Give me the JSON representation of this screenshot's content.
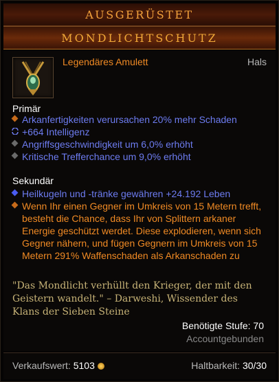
{
  "header": {
    "status": "AUSGERÜSTET",
    "item_name": "MONDLICHTSCHUTZ"
  },
  "item": {
    "type": "Legendäres Amulett",
    "slot": "Hals",
    "icon": "amulet-icon"
  },
  "primary": {
    "title": "Primär",
    "stats": [
      "Arkanfertigkeiten verursachen 20% mehr Schaden",
      "+664 Intelligenz",
      "Angriffsgeschwindigkeit um 6,0% erhöht",
      "Kritische Trefferchance um 9,0% erhöht"
    ]
  },
  "secondary": {
    "title": "Sekundär",
    "stats": [
      "Heilkugeln und -tränke gewähren +24.192 Leben",
      "Wenn Ihr einen Gegner im Umkreis von 15 Metern trefft, besteht die Chance, dass Ihr von Splittern arkaner Energie geschützt werdet. Diese explodieren, wenn sich Gegner nähern, und fügen Gegnern im Umkreis von 15 Metern 291% Waffenschaden als Arkanschaden zu"
    ]
  },
  "flavor": "\"Das Mondlicht verhüllt den Krieger, der mit den Geistern wandelt.\" – Darweshi, Wissender des Klans der Sieben Steine",
  "requirements": {
    "level": "Benötigte Stufe: 70",
    "bound": "Accountgebunden"
  },
  "footer": {
    "sell_label": "Verkaufswert:",
    "sell_value": "5103",
    "durability_label": "Haltbarkeit:",
    "durability_value": "30/30"
  },
  "colors": {
    "legendary": "#f08a24",
    "magic": "#6d7cf1",
    "flavor": "#c7b377"
  }
}
